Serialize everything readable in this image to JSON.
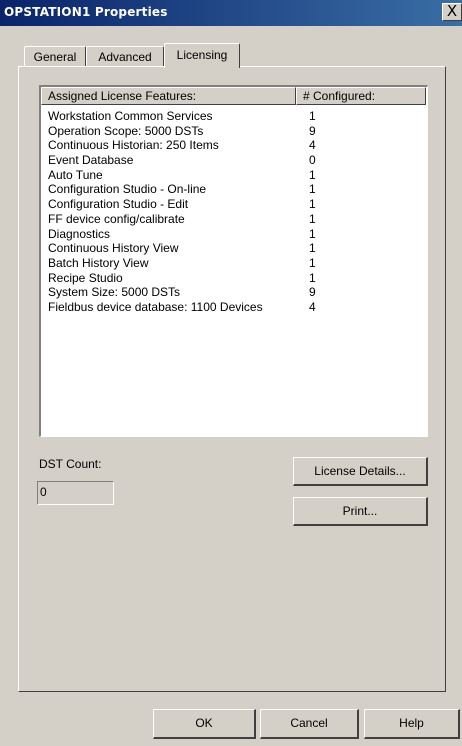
{
  "window": {
    "title": "OPSTATION1 Properties",
    "close_glyph": "X"
  },
  "tabs": [
    {
      "label": "General"
    },
    {
      "label": "Advanced"
    },
    {
      "label": "Licensing",
      "selected": true
    }
  ],
  "licenses": {
    "columns": [
      "Assigned License Features:",
      "# Configured:"
    ],
    "rows": [
      [
        "Workstation Common Services",
        "1"
      ],
      [
        "Operation Scope: 5000 DSTs",
        "9"
      ],
      [
        "Continuous Historian: 250 Items",
        "4"
      ],
      [
        "Event Database",
        "0"
      ],
      [
        "Auto Tune",
        "1"
      ],
      [
        "Configuration Studio - On-line",
        "1"
      ],
      [
        "Configuration Studio - Edit",
        "1"
      ],
      [
        "FF device config/calibrate",
        "1"
      ],
      [
        "Diagnostics",
        "1"
      ],
      [
        "Continuous History View",
        "1"
      ],
      [
        "Batch History View",
        "1"
      ],
      [
        "Recipe Studio",
        "1"
      ],
      [
        "System Size: 5000 DSTs",
        "9"
      ],
      [
        "Fieldbus device database: 1100 Devices",
        "4"
      ]
    ]
  },
  "dst": {
    "label": "DST Count:",
    "value": "0"
  },
  "buttons": {
    "license_details": "License Details...",
    "print": "Print...",
    "ok": "OK",
    "cancel": "Cancel",
    "help": "Help"
  }
}
